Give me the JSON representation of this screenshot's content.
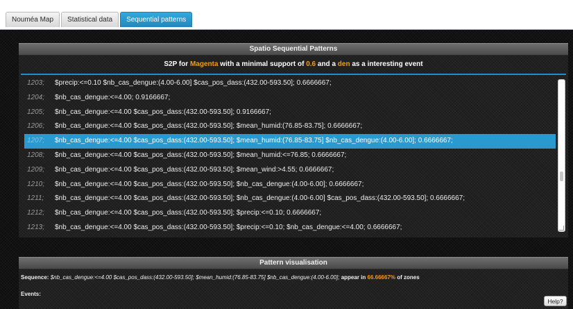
{
  "tabs": [
    "Nouméa Map",
    "Statistical data",
    "Sequential patterns"
  ],
  "patterns_panel": {
    "header": "Spatio Sequential Patterns",
    "subtitle": {
      "part1": "S2P for ",
      "color_value": "Magenta",
      "part2": " with a minimal support of ",
      "support_value": "0.6",
      "part3": " and a ",
      "event_value": "den",
      "part4": " as a interesting event"
    },
    "rows": [
      {
        "num": "1203;",
        "text": "$precip:<=0.10 $nb_cas_dengue:(4.00-6.00] $cas_pos_dass:(432.00-593.50]; 0.6666667;"
      },
      {
        "num": "1204;",
        "text": "$nb_cas_dengue:<=4.00; 0.9166667;"
      },
      {
        "num": "1205;",
        "text": "$nb_cas_dengue:<=4.00 $cas_pos_dass:(432.00-593.50]; 0.9166667;"
      },
      {
        "num": "1206;",
        "text": "$nb_cas_dengue:<=4.00 $cas_pos_dass:(432.00-593.50]; $mean_humid:(76.85-83.75]; 0.6666667;"
      },
      {
        "num": "1207;",
        "text": "$nb_cas_dengue:<=4.00 $cas_pos_dass:(432.00-593.50]; $mean_humid:(76.85-83.75] $nb_cas_dengue:(4.00-6.00]; 0.6666667;"
      },
      {
        "num": "1208;",
        "text": "$nb_cas_dengue:<=4.00 $cas_pos_dass:(432.00-593.50]; $mean_humid:<=76.85; 0.6666667;"
      },
      {
        "num": "1209;",
        "text": "$nb_cas_dengue:<=4.00 $cas_pos_dass:(432.00-593.50]; $mean_wind:>4.55; 0.6666667;"
      },
      {
        "num": "1210;",
        "text": "$nb_cas_dengue:<=4.00 $cas_pos_dass:(432.00-593.50]; $nb_cas_dengue:(4.00-6.00]; 0.6666667;"
      },
      {
        "num": "1211;",
        "text": "$nb_cas_dengue:<=4.00 $cas_pos_dass:(432.00-593.50]; $nb_cas_dengue:(4.00-6.00] $cas_pos_dass:(432.00-593.50]; 0.6666667;"
      },
      {
        "num": "1212;",
        "text": "$nb_cas_dengue:<=4.00 $cas_pos_dass:(432.00-593.50]; $precip:<=0.10; 0.6666667;"
      },
      {
        "num": "1213;",
        "text": "$nb_cas_dengue:<=4.00 $cas_pos_dass:(432.00-593.50]; $precip:<=0.10; $nb_cas_dengue:<=4.00; 0.6666667;"
      }
    ],
    "selected_index": 4
  },
  "viz_panel": {
    "header": "Pattern visualisation",
    "sequence_label": "Sequence:",
    "sequence_value": "$nb_cas_dengue:<=4.00 $cas_pos_dass:(432.00-593.50]; $mean_humid:(76.85-83.75] $nb_cas_dengue:(4.00-6.00];",
    "appear_text": "appear in",
    "percent": "66.66667%",
    "zones_text": "of zones",
    "events_label": "Events:"
  },
  "help_label": "Help?",
  "colors": {
    "accent": "#2a99d0",
    "highlight": "#f29a1c"
  }
}
